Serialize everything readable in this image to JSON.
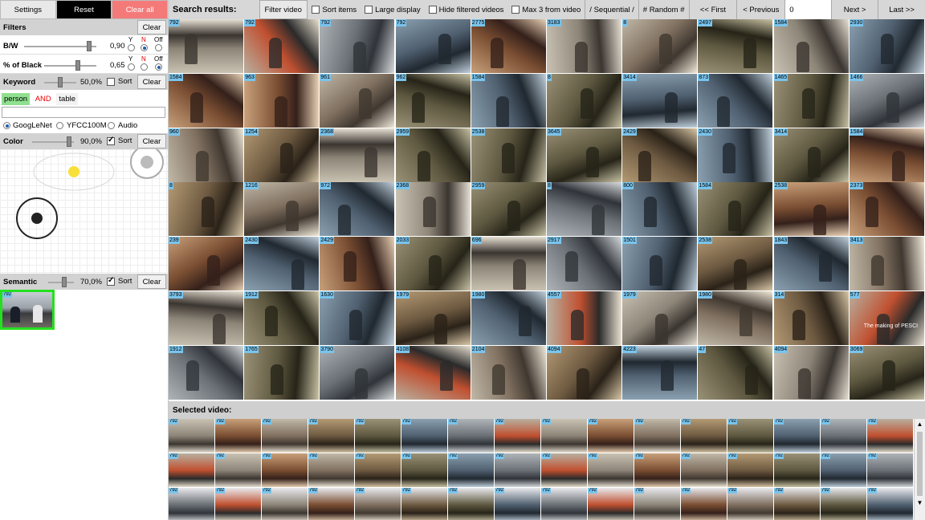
{
  "left": {
    "top_buttons": {
      "settings": "Settings",
      "reset": "Reset",
      "clear_all": "Clear all"
    },
    "filters": {
      "title": "Filters",
      "clear": "Clear",
      "bw": {
        "label": "B/W",
        "value": "0,90",
        "level": 0.9,
        "option": "N"
      },
      "black": {
        "label": "% of Black",
        "value": "0,65",
        "level": 0.65,
        "option": "Off"
      },
      "y": "Y",
      "n": "N",
      "off": "Off"
    },
    "keyword": {
      "title": "Keyword",
      "value": "50,0%",
      "level": 0.5,
      "sort": "Sort",
      "sort_checked": false,
      "clear": "Clear",
      "terms": [
        "person",
        "AND",
        "table"
      ],
      "input_value": "",
      "models": [
        "GoogLeNet",
        "YFCC100M",
        "Audio"
      ],
      "selected_model": "GoogLeNet"
    },
    "color": {
      "title": "Color",
      "value": "90,0%",
      "level": 0.9,
      "sort": "Sort",
      "sort_checked": true,
      "clear": "Clear",
      "dot_color": "#f7e03a"
    },
    "semantic": {
      "title": "Semantic",
      "value": "70,0%",
      "level": 0.7,
      "sort": "Sort",
      "sort_checked": true,
      "clear": "Clear",
      "example_id": "792"
    }
  },
  "toolbar": {
    "search_results": "Search results:",
    "filter_video": "Filter video",
    "sort_items": "Sort items",
    "large_display": "Large display",
    "hide_filtered": "Hide filtered videos",
    "max3": "Max 3 from video",
    "sequential": "/ Sequential /",
    "random": "# Random #",
    "first": "<< First",
    "previous": "< Previous",
    "page": "0",
    "next": "Next >",
    "last": "Last >>"
  },
  "grid_ids": [
    [
      "792",
      "792",
      "792",
      "792",
      "2775",
      "3183",
      "8",
      "2497",
      "1584",
      "2930"
    ],
    [
      "1584",
      "963",
      "961",
      "962",
      "1584",
      "8",
      "3414",
      "873",
      "1465",
      "1466"
    ],
    [
      "960",
      "1254",
      "2368",
      "2959",
      "2538",
      "3645",
      "2429",
      "2430",
      "3414",
      "1584"
    ],
    [
      "8",
      "1216",
      "972",
      "2368",
      "2959",
      "8",
      "800",
      "1584",
      "2538",
      "2373"
    ],
    [
      "239",
      "2430",
      "2429",
      "2033",
      "696",
      "2917",
      "1501",
      "2538",
      "1843",
      "3413"
    ],
    [
      "3793",
      "1912",
      "1630",
      "1979",
      "1980",
      "4557",
      "1979",
      "1980",
      "314",
      "577"
    ],
    [
      "1912",
      "1765",
      "3790",
      "4108",
      "2104",
      "4094",
      "4223",
      "47",
      "4094",
      "3069"
    ]
  ],
  "grid_overlay_text": "The making of PESCI",
  "selected_video": {
    "title": "Selected video:",
    "id": "792"
  }
}
